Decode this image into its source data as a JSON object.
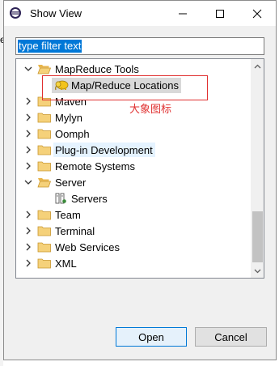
{
  "window": {
    "title": "Show View"
  },
  "background": {
    "edge_char": "e"
  },
  "filter": {
    "value": "type filter text"
  },
  "tree": {
    "items": [
      {
        "label": "MapReduce Tools",
        "expanded": true,
        "icon": "folder-open-icon"
      },
      {
        "label": "Map/Reduce Locations",
        "child": true,
        "icon": "elephant-icon",
        "selected": true
      },
      {
        "label": "Maven",
        "expanded": false,
        "icon": "folder-icon"
      },
      {
        "label": "Mylyn",
        "expanded": false,
        "icon": "folder-icon"
      },
      {
        "label": "Oomph",
        "expanded": false,
        "icon": "folder-icon"
      },
      {
        "label": "Plug-in Development",
        "expanded": false,
        "icon": "folder-icon",
        "hovered": true
      },
      {
        "label": "Remote Systems",
        "expanded": false,
        "icon": "folder-icon"
      },
      {
        "label": "Server",
        "expanded": true,
        "icon": "folder-open-icon"
      },
      {
        "label": "Servers",
        "child": true,
        "icon": "servers-icon"
      },
      {
        "label": "Team",
        "expanded": false,
        "icon": "folder-icon"
      },
      {
        "label": "Terminal",
        "expanded": false,
        "icon": "folder-icon"
      },
      {
        "label": "Web Services",
        "expanded": false,
        "icon": "folder-icon"
      },
      {
        "label": "XML",
        "expanded": false,
        "icon": "folder-icon"
      }
    ]
  },
  "annotation": {
    "text": "大象图标",
    "color": "#e03030"
  },
  "buttons": {
    "open": "Open",
    "cancel": "Cancel"
  },
  "colors": {
    "accent": "#0078d7",
    "folder": "#e8b54a",
    "hover": "#e5f3ff",
    "selection": "#d9d9d9"
  }
}
